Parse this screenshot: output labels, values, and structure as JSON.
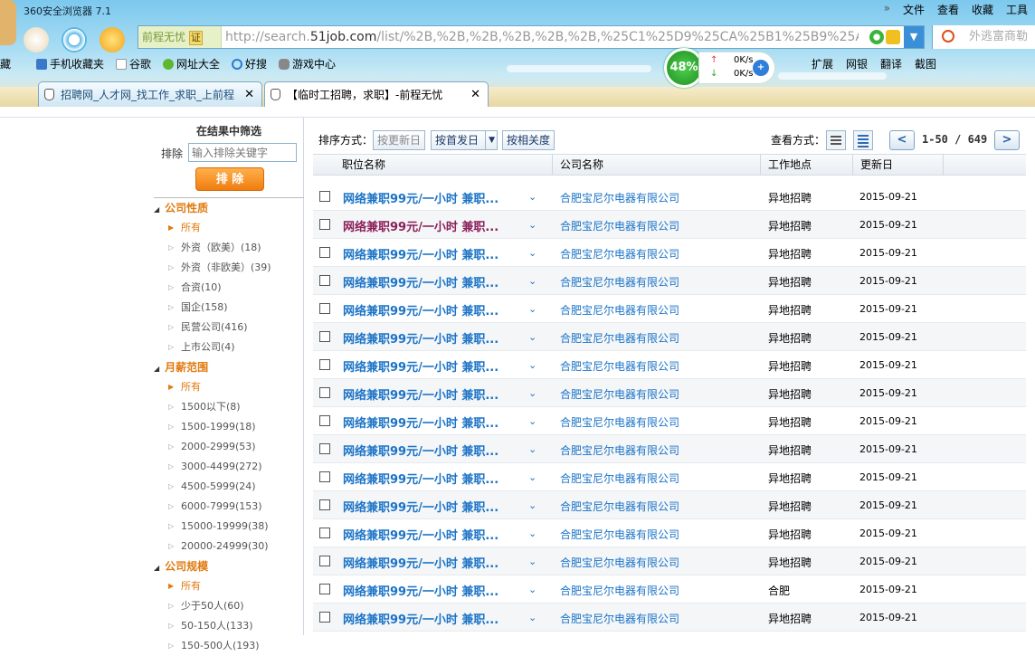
{
  "browser": {
    "title": "360安全浏览器 7.1",
    "menu": [
      "文件",
      "查看",
      "收藏",
      "工具"
    ],
    "address": {
      "badge": "前程无忧",
      "cert": "证",
      "url_prefix": "http://search.",
      "url_domain": "51job.com",
      "url_path": "/list/%2B,%2B,%2B,%2B,%2B,%2B,%25C1%25D9%25CA%25B1%25B9%25A4,"
    },
    "search_placeholder": "外逃富商勒",
    "favorites": [
      "藏",
      "手机收藏夹",
      "谷歌",
      "网址大全",
      "好搜",
      "游戏中心"
    ],
    "right_tools": [
      "扩展",
      "网银",
      "翻译",
      "截图"
    ],
    "net": {
      "percent": "48%",
      "up": "0K/s",
      "down": "0K/s"
    },
    "tabs": [
      {
        "label": "招聘网_人才网_找工作_求职_上前程"
      },
      {
        "label": "【临时工招聘，求职】-前程无忧"
      }
    ],
    "icon_names": [
      "shield-icon",
      "refresh-icon",
      "lightning-icon",
      "search-icon",
      "hand-icon",
      "close-icon"
    ]
  },
  "sidebar": {
    "title": "在结果中筛选",
    "exclude_label": "排除",
    "exclude_placeholder": "输入排除关键字",
    "exclude_button": "排 除",
    "groups": [
      {
        "title": "公司性质",
        "options": [
          "所有",
          "外资（欧美）(18)",
          "外资（非欧美）(39)",
          "合资(10)",
          "国企(158)",
          "民营公司(416)",
          "上市公司(4)"
        ]
      },
      {
        "title": "月薪范围",
        "options": [
          "所有",
          "1500以下(8)",
          "1500-1999(18)",
          "2000-2999(53)",
          "3000-4499(272)",
          "4500-5999(24)",
          "6000-7999(153)",
          "15000-19999(38)",
          "20000-24999(30)"
        ]
      },
      {
        "title": "公司规模",
        "options": [
          "所有",
          "少于50人(60)",
          "50-150人(133)",
          "150-500人(193)"
        ]
      }
    ]
  },
  "toolbar": {
    "sort_label": "排序方式：",
    "sort_buttons": [
      "按更新日",
      "按首发日",
      "按相关度"
    ],
    "view_label": "查看方式：",
    "pager": "1-50 / 649"
  },
  "table": {
    "headers": [
      "职位名称",
      "公司名称",
      "工作地点",
      "更新日"
    ],
    "rows": [
      {
        "job": "网络兼职99元/一小时 兼职...",
        "company": "合肥宝尼尔电器有限公司",
        "location": "异地招聘",
        "date": "2015-09-21"
      },
      {
        "job": "网络兼职99元/一小时 兼职...",
        "company": "合肥宝尼尔电器有限公司",
        "location": "异地招聘",
        "date": "2015-09-21"
      },
      {
        "job": "网络兼职99元/一小时 兼职...",
        "company": "合肥宝尼尔电器有限公司",
        "location": "异地招聘",
        "date": "2015-09-21"
      },
      {
        "job": "网络兼职99元/一小时 兼职...",
        "company": "合肥宝尼尔电器有限公司",
        "location": "异地招聘",
        "date": "2015-09-21"
      },
      {
        "job": "网络兼职99元/一小时 兼职...",
        "company": "合肥宝尼尔电器有限公司",
        "location": "异地招聘",
        "date": "2015-09-21"
      },
      {
        "job": "网络兼职99元/一小时 兼职...",
        "company": "合肥宝尼尔电器有限公司",
        "location": "异地招聘",
        "date": "2015-09-21"
      },
      {
        "job": "网络兼职99元/一小时 兼职...",
        "company": "合肥宝尼尔电器有限公司",
        "location": "异地招聘",
        "date": "2015-09-21"
      },
      {
        "job": "网络兼职99元/一小时 兼职...",
        "company": "合肥宝尼尔电器有限公司",
        "location": "异地招聘",
        "date": "2015-09-21"
      },
      {
        "job": "网络兼职99元/一小时 兼职...",
        "company": "合肥宝尼尔电器有限公司",
        "location": "异地招聘",
        "date": "2015-09-21"
      },
      {
        "job": "网络兼职99元/一小时 兼职...",
        "company": "合肥宝尼尔电器有限公司",
        "location": "异地招聘",
        "date": "2015-09-21"
      },
      {
        "job": "网络兼职99元/一小时 兼职...",
        "company": "合肥宝尼尔电器有限公司",
        "location": "异地招聘",
        "date": "2015-09-21"
      },
      {
        "job": "网络兼职99元/一小时 兼职...",
        "company": "合肥宝尼尔电器有限公司",
        "location": "异地招聘",
        "date": "2015-09-21"
      },
      {
        "job": "网络兼职99元/一小时 兼职...",
        "company": "合肥宝尼尔电器有限公司",
        "location": "异地招聘",
        "date": "2015-09-21"
      },
      {
        "job": "网络兼职99元/一小时 兼职...",
        "company": "合肥宝尼尔电器有限公司",
        "location": "异地招聘",
        "date": "2015-09-21"
      },
      {
        "job": "网络兼职99元/一小时 兼职...",
        "company": "合肥宝尼尔电器有限公司",
        "location": "合肥",
        "date": "2015-09-21"
      },
      {
        "job": "网络兼职99元/一小时 兼职...",
        "company": "合肥宝尼尔电器有限公司",
        "location": "异地招聘",
        "date": "2015-09-21"
      }
    ]
  },
  "colors": {
    "link": "#1b73c6",
    "visited": "#8b1f5a",
    "accent": "#e07a10"
  }
}
